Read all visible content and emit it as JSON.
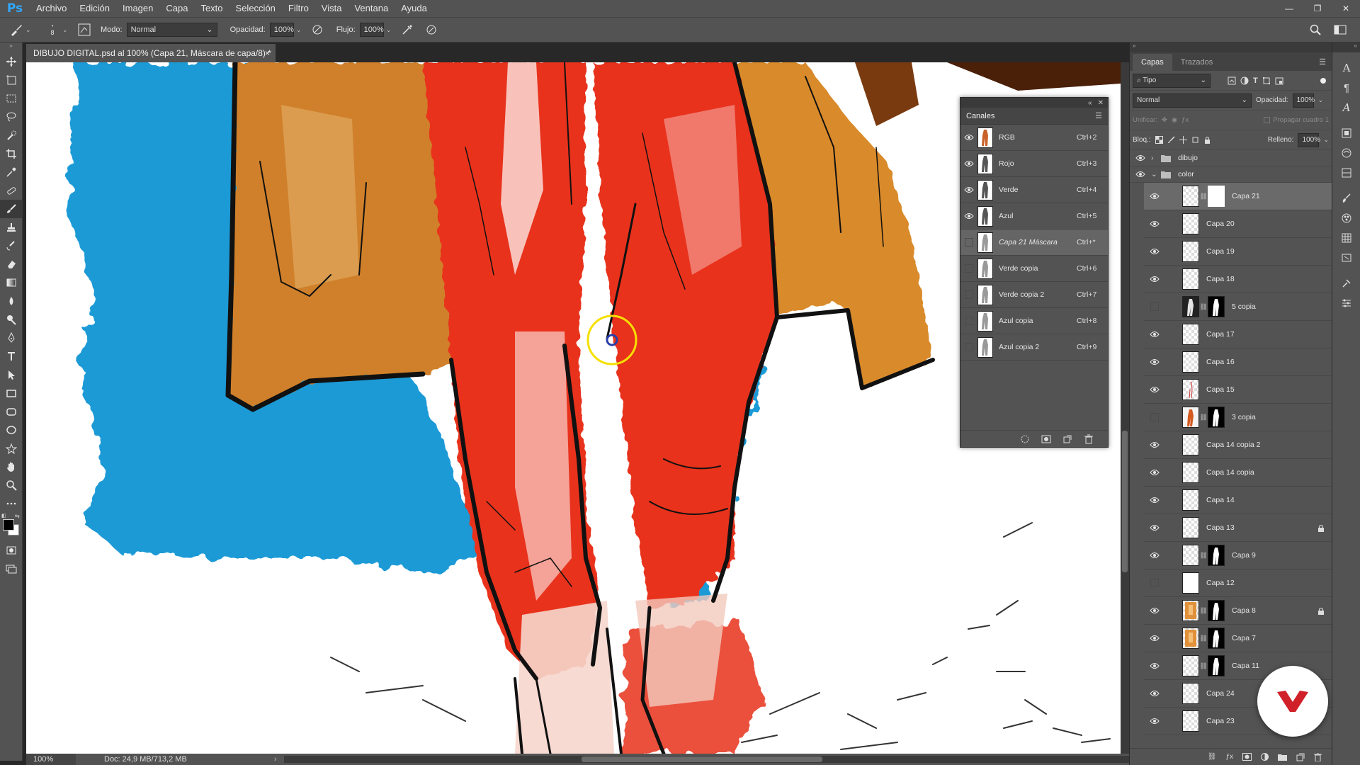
{
  "app": {
    "logo": "Ps"
  },
  "menu": [
    "Archivo",
    "Edición",
    "Imagen",
    "Capa",
    "Texto",
    "Selección",
    "Filtro",
    "Vista",
    "Ventana",
    "Ayuda"
  ],
  "options": {
    "brush_size": "8",
    "mode_label": "Modo:",
    "mode_value": "Normal",
    "opacity_label": "Opacidad:",
    "opacity_value": "100%",
    "flow_label": "Flujo:",
    "flow_value": "100%"
  },
  "document": {
    "tab_title": "DIBUJO DIGITAL.psd al 100% (Capa 21, Máscara de capa/8) *",
    "close_glyph": "×"
  },
  "status": {
    "zoom": "100%",
    "doc_info": "Doc: 24,9 MB/713,2 MB"
  },
  "channels_panel": {
    "title": "Canales",
    "channels": [
      {
        "name": "RGB",
        "shortcut": "Ctrl+2",
        "visible": true,
        "selected": false
      },
      {
        "name": "Rojo",
        "shortcut": "Ctrl+3",
        "visible": true,
        "selected": false
      },
      {
        "name": "Verde",
        "shortcut": "Ctrl+4",
        "visible": true,
        "selected": false
      },
      {
        "name": "Azul",
        "shortcut": "Ctrl+5",
        "visible": true,
        "selected": false
      },
      {
        "name": "Capa 21 Máscara",
        "shortcut": "Ctrl+*",
        "visible": false,
        "selected": true
      },
      {
        "name": "Verde copia",
        "shortcut": "Ctrl+6",
        "visible": false,
        "selected": false
      },
      {
        "name": "Verde copia 2",
        "shortcut": "Ctrl+7",
        "visible": false,
        "selected": false
      },
      {
        "name": "Azul copia",
        "shortcut": "Ctrl+8",
        "visible": false,
        "selected": false
      },
      {
        "name": "Azul copia 2",
        "shortcut": "Ctrl+9",
        "visible": false,
        "selected": false
      }
    ]
  },
  "layers_panel": {
    "tabs": [
      "Capas",
      "Trazados"
    ],
    "filter_label": "Tipo",
    "blend_mode": "Normal",
    "opacity_label": "Opacidad:",
    "opacity_value": "100%",
    "unify_label": "Unificar:",
    "propagate_label": "Propagar cuadro 1",
    "lock_label": "Bloq.:",
    "fill_label": "Relleno:",
    "fill_value": "100%",
    "groups": [
      {
        "name": "dibujo",
        "expanded": false
      },
      {
        "name": "color",
        "expanded": true
      }
    ],
    "layers": [
      {
        "name": "Capa 21",
        "visible": true,
        "mask": true,
        "selected": true,
        "locked": false,
        "thumb": "blank"
      },
      {
        "name": "Capa 20",
        "visible": true,
        "mask": false,
        "selected": false,
        "locked": false,
        "thumb": "blank"
      },
      {
        "name": "Capa 19",
        "visible": true,
        "mask": false,
        "selected": false,
        "locked": false,
        "thumb": "blank"
      },
      {
        "name": "Capa 18",
        "visible": true,
        "mask": false,
        "selected": false,
        "locked": false,
        "thumb": "blank"
      },
      {
        "name": "5 copia",
        "visible": false,
        "mask": true,
        "selected": false,
        "locked": false,
        "thumb": "figure-dark"
      },
      {
        "name": "Capa 17",
        "visible": true,
        "mask": false,
        "selected": false,
        "locked": false,
        "thumb": "blank"
      },
      {
        "name": "Capa 16",
        "visible": true,
        "mask": false,
        "selected": false,
        "locked": false,
        "thumb": "blank"
      },
      {
        "name": "Capa 15",
        "visible": true,
        "mask": false,
        "selected": false,
        "locked": false,
        "thumb": "sketch"
      },
      {
        "name": "3 copia",
        "visible": false,
        "mask": true,
        "selected": false,
        "locked": false,
        "thumb": "figure-color"
      },
      {
        "name": "Capa 14 copia 2",
        "visible": true,
        "mask": false,
        "selected": false,
        "locked": false,
        "thumb": "blank"
      },
      {
        "name": "Capa 14 copia",
        "visible": true,
        "mask": false,
        "selected": false,
        "locked": false,
        "thumb": "blank"
      },
      {
        "name": "Capa 14",
        "visible": true,
        "mask": false,
        "selected": false,
        "locked": false,
        "thumb": "blank"
      },
      {
        "name": "Capa 13",
        "visible": true,
        "mask": false,
        "selected": false,
        "locked": true,
        "thumb": "blank"
      },
      {
        "name": "Capa 9",
        "visible": true,
        "mask": true,
        "selected": false,
        "locked": false,
        "thumb": "blank"
      },
      {
        "name": "Capa 12",
        "visible": false,
        "mask": false,
        "selected": false,
        "locked": false,
        "thumb": "white"
      },
      {
        "name": "Capa 8",
        "visible": true,
        "mask": true,
        "selected": false,
        "locked": true,
        "thumb": "orange"
      },
      {
        "name": "Capa 7",
        "visible": true,
        "mask": true,
        "selected": false,
        "locked": false,
        "thumb": "orange"
      },
      {
        "name": "Capa 11",
        "visible": true,
        "mask": true,
        "selected": false,
        "locked": false,
        "thumb": "blank"
      },
      {
        "name": "Capa 24",
        "visible": true,
        "mask": false,
        "selected": false,
        "locked": false,
        "thumb": "blank"
      },
      {
        "name": "Capa 23",
        "visible": true,
        "mask": false,
        "selected": false,
        "locked": false,
        "thumb": "blank"
      }
    ]
  },
  "colors": {
    "ui_dark": "#282828",
    "ui_panel": "#535353",
    "accent_ps": "#31a8ff",
    "paint_red": "#e8331f",
    "paint_blue": "#1d9ad6",
    "paint_orange": "#d0802a",
    "brush_cursor": "#f5e000",
    "badge_red": "#d0202a"
  }
}
